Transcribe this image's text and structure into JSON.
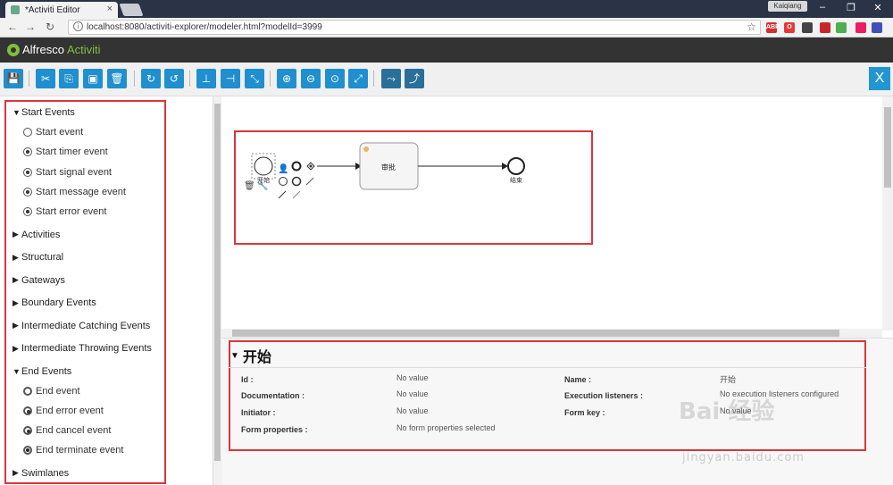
{
  "browser": {
    "tab_title": "*Activiti Editor",
    "user": "Kaiqiang",
    "window_controls": [
      "–",
      "❐",
      "✕"
    ],
    "url": "localhost:8080/activiti-explorer/modeler.html?modelId=3999",
    "extensions": [
      {
        "label": "ABP",
        "color": "#d32f2f"
      },
      {
        "label": "O",
        "color": "#e53935"
      },
      {
        "label": "",
        "color": "#444"
      },
      {
        "label": "",
        "color": "#c62828"
      },
      {
        "label": "",
        "color": "#4caf50"
      },
      {
        "label": "",
        "color": "#e91e63"
      },
      {
        "label": "",
        "color": "#3f51b5"
      },
      {
        "label": "",
        "color": "#1565c0"
      },
      {
        "label": "",
        "color": "#555"
      }
    ]
  },
  "app": {
    "brand_part1": "Alfresco",
    "brand_part2": "Activiti"
  },
  "toolbar": {
    "close_label": "X",
    "buttons": [
      {
        "name": "save-button",
        "glyph": "💾"
      },
      {
        "name": "cut-button",
        "glyph": "✂"
      },
      {
        "name": "copy-button",
        "glyph": "⎘"
      },
      {
        "name": "paste-button",
        "glyph": "▣"
      },
      {
        "name": "delete-button",
        "glyph": "🗑"
      },
      {
        "name": "redo-button",
        "glyph": "↻"
      },
      {
        "name": "undo-button",
        "glyph": "↺"
      },
      {
        "name": "align-horizontal-button",
        "glyph": "⊥"
      },
      {
        "name": "align-vertical-button",
        "glyph": "⊣"
      },
      {
        "name": "same-size-button",
        "glyph": "⤡"
      },
      {
        "name": "zoom-in-button",
        "glyph": "⊕"
      },
      {
        "name": "zoom-out-button",
        "glyph": "⊖"
      },
      {
        "name": "zoom-actual-button",
        "glyph": "⊙"
      },
      {
        "name": "zoom-fit-button",
        "glyph": "⤢"
      },
      {
        "name": "bend-add-button",
        "glyph": "⤳"
      },
      {
        "name": "bend-remove-button",
        "glyph": "⤴"
      }
    ]
  },
  "palette": {
    "groups": [
      {
        "label": "Start Events",
        "expanded": true,
        "items": [
          "Start event",
          "Start timer event",
          "Start signal event",
          "Start message event",
          "Start error event"
        ]
      },
      {
        "label": "Activities",
        "expanded": false,
        "items": []
      },
      {
        "label": "Structural",
        "expanded": false,
        "items": []
      },
      {
        "label": "Gateways",
        "expanded": false,
        "items": []
      },
      {
        "label": "Boundary Events",
        "expanded": false,
        "items": []
      },
      {
        "label": "Intermediate Catching Events",
        "expanded": false,
        "items": []
      },
      {
        "label": "Intermediate Throwing Events",
        "expanded": false,
        "items": []
      },
      {
        "label": "End Events",
        "expanded": true,
        "items": [
          "End event",
          "End error event",
          "End cancel event",
          "End terminate event"
        ]
      },
      {
        "label": "Swimlanes",
        "expanded": false,
        "items": []
      }
    ]
  },
  "diagram": {
    "start_label": "开始",
    "task_label": "审批",
    "end_label": "结束"
  },
  "properties": {
    "title": "开始",
    "rows": [
      {
        "label": "Id :",
        "value": "No value",
        "label2": "Name :",
        "value2": "开始"
      },
      {
        "label": "Documentation :",
        "value": "No value",
        "label2": "Execution listeners :",
        "value2": "No execution listeners configured"
      },
      {
        "label": "Initiator :",
        "value": "No value",
        "label2": "Form key :",
        "value2": "No value"
      },
      {
        "label": "Form properties :",
        "value": "No form properties selected",
        "label2": "",
        "value2": ""
      }
    ]
  },
  "watermark": {
    "text": "Bai 经验",
    "url": "jingyan.baidu.com"
  }
}
